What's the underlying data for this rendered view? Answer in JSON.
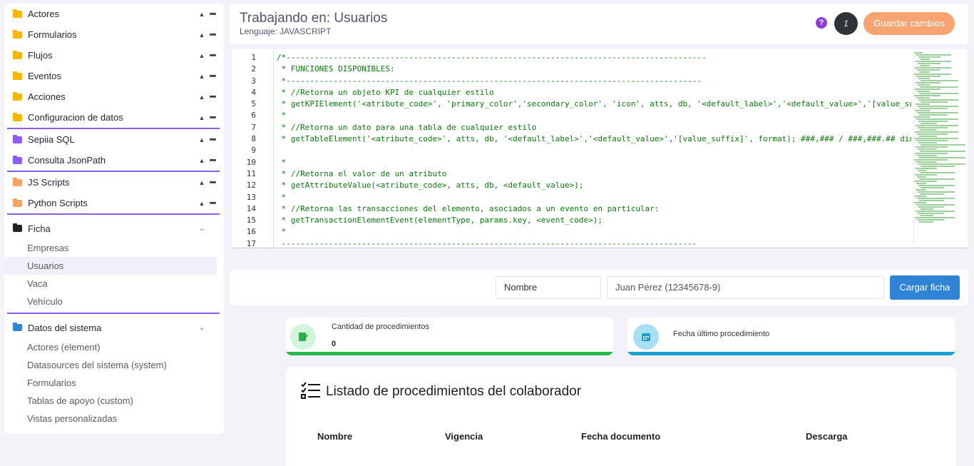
{
  "sidebar": {
    "groups": [
      {
        "items": [
          {
            "label": "Actores",
            "color": "#f5b800"
          },
          {
            "label": "Formularios",
            "color": "#f5b800"
          },
          {
            "label": "Flujos",
            "color": "#f5b800"
          },
          {
            "label": "Eventos",
            "color": "#f5b800"
          },
          {
            "label": "Acciones",
            "color": "#f5b800"
          },
          {
            "label": "Configuracion de datos",
            "color": "#f5b800"
          }
        ]
      },
      {
        "items": [
          {
            "label": "Sepiia SQL",
            "color": "#8b5cf6"
          },
          {
            "label": "Consulta JsonPath",
            "color": "#8b5cf6"
          }
        ]
      },
      {
        "items": [
          {
            "label": "JS Scripts",
            "color": "#f5a462"
          },
          {
            "label": "Python Scripts",
            "color": "#f5a462"
          }
        ]
      }
    ],
    "ficha": {
      "label": "Ficha",
      "color": "#222222",
      "children": [
        "Empresas",
        "Usuarios",
        "Vaca",
        "Vehículo"
      ],
      "active": "Usuarios"
    },
    "sistema": {
      "label": "Datos del sistema",
      "color": "#2f86d6",
      "children": [
        "Actores (element)",
        "Datasources del sistema (system)",
        "Formularios",
        "Tablas de apoyo (custom)",
        "Vistas personalizadas"
      ]
    }
  },
  "header": {
    "title": "Trabajando en: Usuarios",
    "subtitle": "Lenguaje: JAVASCRIPT",
    "help_label": "?",
    "toggle_label": "⁒",
    "save_label": "Guardar cambios"
  },
  "editor": {
    "lines": [
      "/*-----------------------------------------------------------------------------------------",
      " * FUNCIONES DISPONIBLES:",
      " *----------------------------------------------------------------------------------------",
      " * //Retorna un objeto KPI de cualquier estilo",
      " * getKPIElement('<atribute_code>', 'primary_color','secondary_color', 'icon', atts, db, '<default_label>','<default_value>','[value_suff",
      " *",
      " * //Retorna un dato para una tabla de cualquier estilo",
      " * getTableElement('<atribute_code>', atts, db, '<default_label>','<default_value>','[value_suffix]', format); ###,### / ###,###.## diner",
      "",
      " *",
      " * //Retorna el valor de un atributo",
      " * getAttributeValue(<atribute_code>, atts, db, <default_value>);",
      " *",
      " * //Retorna las transacciones del elemento, asociados a un evento en particular:",
      " * getTransactionElementEvent(elementType, params.key, <event_code>);",
      " *",
      " ----------------------------------------------------------------------------------------"
    ]
  },
  "form": {
    "select_value": "Nombre",
    "input_value": "Juan Pérez (12345678-9)",
    "load_label": "Cargar ficha"
  },
  "kpis": {
    "procedures_label": "Cantidad de procedimientos",
    "procedures_value": "0",
    "last_label": "Fecha último procedimiento"
  },
  "list": {
    "title": "Listado de procedimientos del colaborador",
    "columns": [
      "Nombre",
      "Vigencia",
      "Fecha documento",
      "Descarga"
    ]
  }
}
